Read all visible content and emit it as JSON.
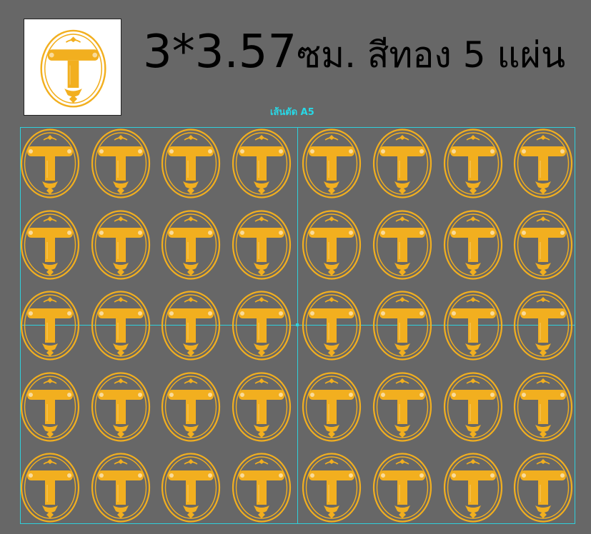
{
  "spec": {
    "dimensions": "3*3.57",
    "description": "ซม. สีทอง 5 แผ่น"
  },
  "cut_line_label": "เส้นตัด A5",
  "colors": {
    "background": "#676767",
    "gold": "#F2AF1F",
    "guide": "#2FD0DC"
  },
  "preview": {
    "icon": "gold-letter-t-oval-emblem"
  },
  "sheet": {
    "rows": 5,
    "columns": 8,
    "icon": "gold-letter-t-oval-emblem"
  }
}
